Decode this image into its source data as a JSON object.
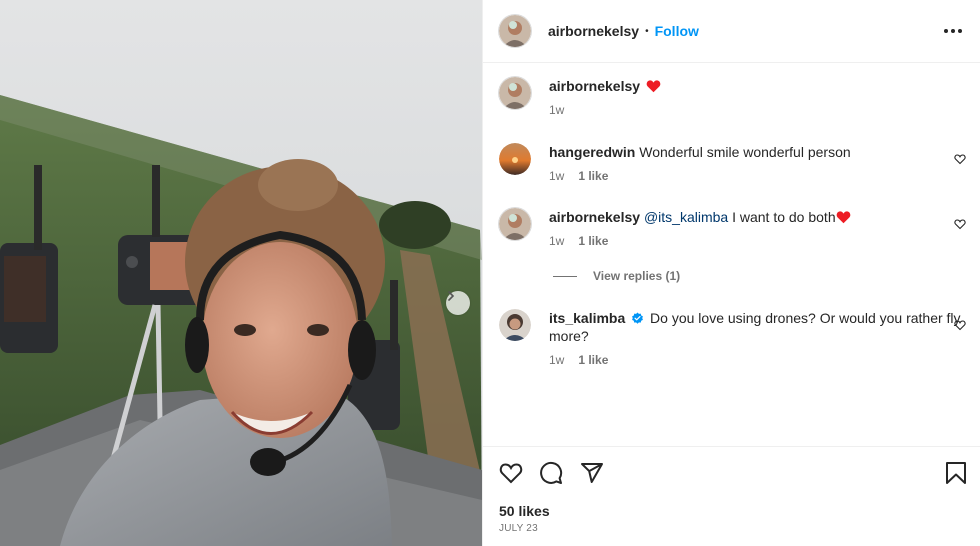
{
  "post": {
    "author": "airbornekelsy",
    "follow_label": "Follow",
    "caption_time": "1w",
    "likes": "50 likes",
    "date": "JULY 23"
  },
  "comments": [
    {
      "user": "hangeredwin",
      "text": "Wonderful smile wonderful person",
      "time": "1w",
      "likes": "1 like"
    },
    {
      "user": "airbornekelsy",
      "mention": "@its_kalimba",
      "text": " I want to do both",
      "time": "1w",
      "likes": "1 like"
    },
    {
      "user": "its_kalimba",
      "verified": true,
      "text": "Do you love using drones? Or would you rather fly more?",
      "time": "1w",
      "likes": "1 like"
    }
  ],
  "view_replies": "View replies (1)",
  "icons": {
    "more": "more-options-icon",
    "heart": "heart-icon",
    "comment": "comment-icon",
    "share": "share-icon",
    "save": "bookmark-icon",
    "next": "chevron-right-icon",
    "verified": "verified-badge-icon"
  },
  "colors": {
    "follow": "#0095f6",
    "heart": "#ed1c24",
    "verified": "#0095f6",
    "mention": "#00376b"
  }
}
